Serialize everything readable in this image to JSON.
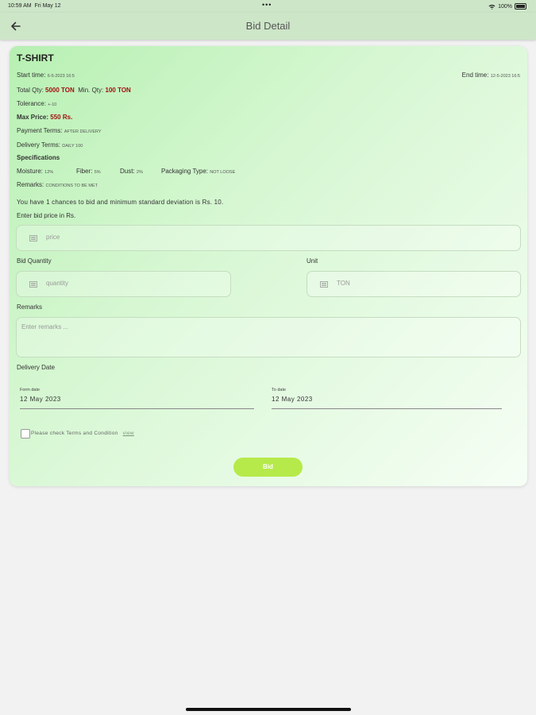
{
  "status_bar": {
    "time": "10:59 AM",
    "date": "Fri May 12",
    "dots": "•••",
    "battery": "100%"
  },
  "header": {
    "title": "Bid Detail"
  },
  "product": {
    "name": "T-SHIRT",
    "start_label": "Start time:",
    "start_value": "6-5-2023 16:5",
    "end_label": "End time:",
    "end_value": "12-5-2023 16:5",
    "total_qty_label": "Total Qty:",
    "total_qty_value": "5000 TON",
    "min_qty_label": "Min. Qty:",
    "min_qty_value": "100 TON",
    "tolerance_label": "Tolerance:",
    "tolerance_value": "+-10",
    "max_price_label": "Max Price:",
    "max_price_value": "550 Rs.",
    "payment_label": "Payment Terms:",
    "payment_value": "AFTER DELIVERY",
    "delivery_label": "Delivery Terms:",
    "delivery_value": "DAILY 100",
    "spec_heading": "Specifications",
    "specs": [
      {
        "label": "Moisture:",
        "value": "12%"
      },
      {
        "label": "Fiber:",
        "value": "5%"
      },
      {
        "label": "Dust:",
        "value": "2%"
      },
      {
        "label": "Packaging Type:",
        "value": "NOT LOOSE"
      }
    ],
    "remarks_label": "Remarks:",
    "remarks_value": "CONDITIONS TO BE MET"
  },
  "form": {
    "info_text": "You have 1 chances to bid and minimum standard deviation is Rs. 10.",
    "price_label": "Enter bid price in Rs.",
    "price_placeholder": "price",
    "qty_label": "Bid Quantity",
    "qty_placeholder": "quantity",
    "unit_label": "Unit",
    "unit_value": "TON",
    "remarks_label": "Remarks",
    "remarks_placeholder": "Enter remarks ...",
    "delivery_date_label": "Delivery Date",
    "from_label": "Form date",
    "from_value": "12 May 2023",
    "to_label": "To date",
    "to_value": "12 May 2023",
    "terms_text": "Please check Terms and Condition",
    "terms_link": "view",
    "bid_button": "Bid"
  },
  "colors": {
    "accent": "#b6ea4a",
    "header_bg": "#cde6c8",
    "highlight": "#a01010"
  }
}
